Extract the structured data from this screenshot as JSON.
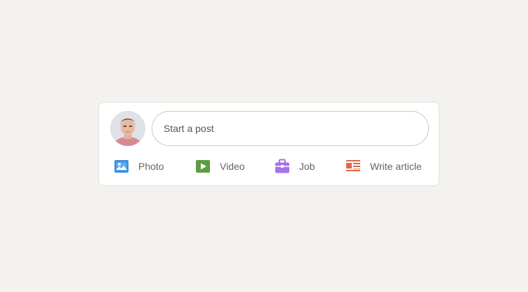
{
  "composer": {
    "placeholder": "Start a post",
    "actions": [
      {
        "id": "photo",
        "label": "Photo",
        "icon": "photo-icon",
        "color": "#378fe9"
      },
      {
        "id": "video",
        "label": "Video",
        "icon": "video-icon",
        "color": "#5f9b41"
      },
      {
        "id": "job",
        "label": "Job",
        "icon": "job-icon",
        "color": "#a872e8"
      },
      {
        "id": "article",
        "label": "Write article",
        "icon": "article-icon",
        "color": "#e06847"
      }
    ]
  }
}
